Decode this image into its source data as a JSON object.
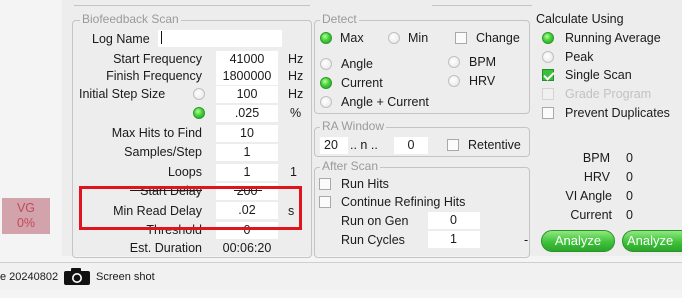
{
  "biofeedback": {
    "title": "Biofeedback Scan",
    "log_name_label": "Log Name",
    "log_name_value": "",
    "rows": [
      {
        "label": "Start Frequency",
        "value": "41000",
        "unit": "Hz"
      },
      {
        "label": "Finish Frequency",
        "value": "1800000",
        "unit": "Hz"
      },
      {
        "label": "Initial Step Size",
        "value": "100",
        "unit": "Hz"
      },
      {
        "label": "",
        "value": ".025",
        "unit": "%"
      },
      {
        "label": "Max Hits to Find",
        "value": "10",
        "unit": ""
      },
      {
        "label": "Samples/Step",
        "value": "1",
        "unit": ""
      },
      {
        "label": "Loops",
        "value": "1",
        "unit": "1"
      },
      {
        "label": "Start Delay",
        "value": "200",
        "unit": ""
      },
      {
        "label": "Min  Read Delay",
        "value": ".02",
        "unit": "s"
      },
      {
        "label": "Threshold",
        "value": "0",
        "unit": ""
      },
      {
        "label": "Est. Duration",
        "value": "00:06:20",
        "unit": ""
      }
    ]
  },
  "detect": {
    "title": "Detect",
    "max_label": "Max",
    "min_label": "Min",
    "change_label": "Change",
    "angle_label": "Angle",
    "current_label": "Current",
    "angle_current_label": "Angle + Current",
    "bpm_label": "BPM",
    "hrv_label": "HRV"
  },
  "ra_window": {
    "title": "RA Window",
    "from_value": "20",
    "n_label": ".. n ..",
    "to_value": "0",
    "retentive_label": "Retentive"
  },
  "after_scan": {
    "title": "After Scan",
    "run_hits_label": "Run Hits",
    "continue_label": "Continue Refining Hits",
    "run_on_gen_label": "Run on Gen",
    "run_on_gen_value": "0",
    "run_cycles_label": "Run Cycles",
    "run_cycles_value": "1",
    "dash": "-"
  },
  "calculate": {
    "title": "Calculate Using",
    "running_average_label": "Running Average",
    "peak_label": "Peak",
    "single_scan_label": "Single Scan",
    "grade_program_label": "Grade Program",
    "prevent_duplicates_label": "Prevent Duplicates"
  },
  "readouts": [
    {
      "label": "BPM",
      "value": "0"
    },
    {
      "label": "HRV",
      "value": "0"
    },
    {
      "label": "VI Angle",
      "value": "0"
    },
    {
      "label": "Current",
      "value": "0"
    }
  ],
  "buttons": {
    "analyze_1": "Analyze",
    "analyze_2": "Analyze"
  },
  "vg_indicator": {
    "label": "VG",
    "value": "0%"
  },
  "statusbar": {
    "date_text": "e 20240802",
    "screenshot_label": "Screen shot"
  },
  "colors": {
    "highlight": "#e0141c",
    "radio_on": "#3cc23a",
    "vg_background": "#d2a3ab",
    "button_green": "#3fc23a"
  }
}
